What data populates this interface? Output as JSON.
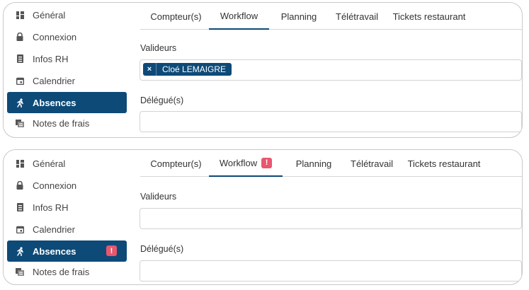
{
  "panels": [
    {
      "sidebar": [
        "Général",
        "Connexion",
        "Infos RH",
        "Calendrier",
        "Absences",
        "Notes de frais"
      ],
      "sidebar_badge": "",
      "tabs": [
        "Compteur(s)",
        "Workflow",
        "Planning",
        "Télétravail",
        "Tickets restaurant"
      ],
      "workflow_badge": "",
      "validators_label": "Valideurs",
      "validator_chip": "Cloé LEMAIGRE",
      "chip_remove": "×",
      "delegates_label": "Délégué(s)"
    },
    {
      "sidebar": [
        "Général",
        "Connexion",
        "Infos RH",
        "Calendrier",
        "Absences",
        "Notes de frais"
      ],
      "sidebar_badge": "!",
      "tabs": [
        "Compteur(s)",
        "Workflow",
        "Planning",
        "Télétravail",
        "Tickets restaurant"
      ],
      "workflow_badge": "!",
      "validators_label": "Valideurs",
      "delegates_label": "Délégué(s)"
    }
  ],
  "colors": {
    "accent": "#0d4a78",
    "alert": "#e8576e",
    "border": "#d3d3d3"
  },
  "icons": [
    "dashboard-icon",
    "lock-icon",
    "id-card-icon",
    "calendar-icon",
    "running-person-icon",
    "receipt-icon"
  ]
}
